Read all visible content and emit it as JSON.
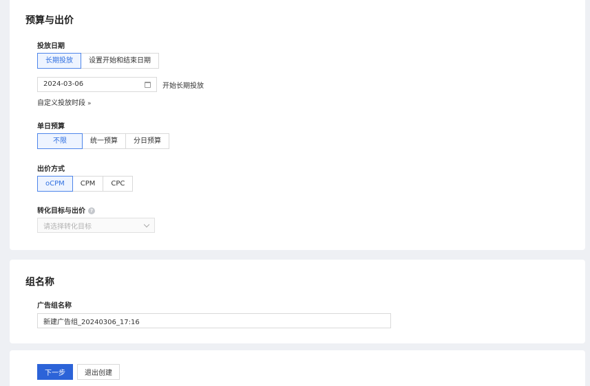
{
  "budget": {
    "title": "预算与出价",
    "date": {
      "label": "投放日期",
      "options": [
        "长期投放",
        "设置开始和结束日期"
      ],
      "selected": 0,
      "value": "2024-03-06",
      "note": "开始长期投放",
      "custom_link": "自定义投放时段"
    },
    "daily": {
      "label": "单日预算",
      "options": [
        "不限",
        "统一预算",
        "分日预算"
      ],
      "selected": 0
    },
    "bid": {
      "label": "出价方式",
      "options": [
        "oCPM",
        "CPM",
        "CPC"
      ],
      "selected": 0
    },
    "target": {
      "label": "转化目标与出价",
      "help_icon": "question-circle-icon",
      "placeholder": "请选择转化目标"
    }
  },
  "group": {
    "title": "组名称",
    "name_label": "广告组名称",
    "name_value": "新建广告组_20240306_17:16"
  },
  "actions": {
    "next": "下一步",
    "exit": "退出创建"
  },
  "colors": {
    "accent": "#2c63d8",
    "active_border": "#4c84ea",
    "active_bg": "#eef4ff"
  }
}
